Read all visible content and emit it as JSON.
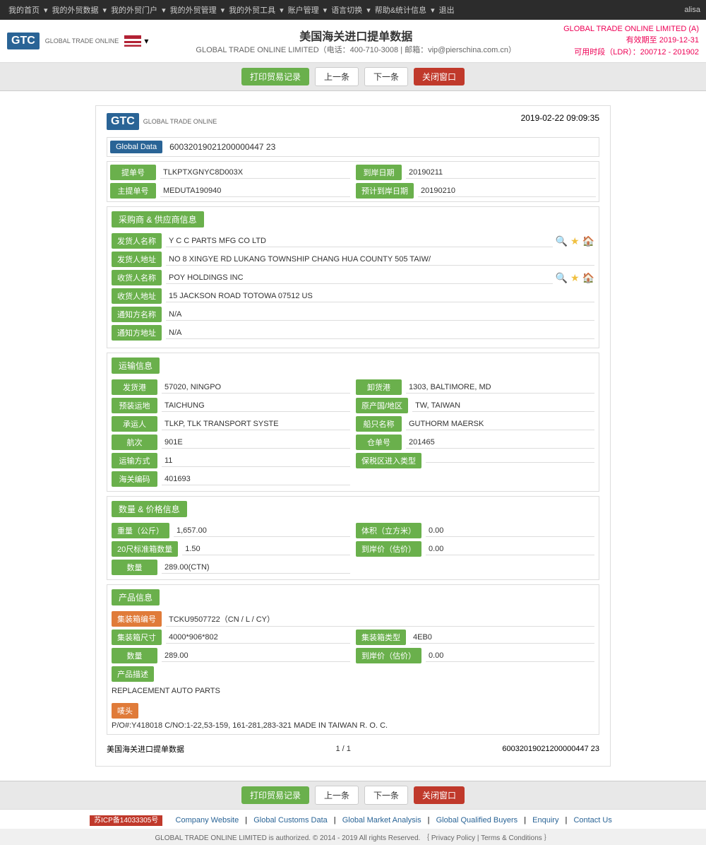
{
  "topnav": {
    "items": [
      "我的首页",
      "我的外贸数据",
      "我的外贸门户",
      "我的外贸管理",
      "我的外贸工具",
      "账户管理",
      "语言切换",
      "帮助&统计信息",
      "退出"
    ],
    "user": "alisa"
  },
  "header": {
    "logo": "GTC",
    "logo_sub": "GLOBAL TRADE ONLINE",
    "country": "美国海关进口提单数据",
    "company": "GLOBAL TRADE ONLINE LIMITED（电话：400-710-3008 | 邮箱：vip@pierschina.com.cn）",
    "account_title": "GLOBAL TRADE ONLINE LIMITED (A)",
    "valid_until": "有效期至 2019-12-31",
    "available_time": "可用时段（LDR）：200712 - 201902"
  },
  "toolbar": {
    "print_label": "打印贸易记录",
    "prev_label": "上一条",
    "next_label": "下一条",
    "close_label": "关闭窗口"
  },
  "document": {
    "timestamp": "2019-02-22 09:09:35",
    "global_data_label": "Global Data",
    "global_data_value": "60032019021200000447 23",
    "bill_no_label": "提单号",
    "bill_no_value": "TLKPTXGNYC8D003X",
    "arrival_date_label": "到岸日期",
    "arrival_date_value": "20190211",
    "master_bill_label": "主提单号",
    "master_bill_value": "MEDUTA190940",
    "est_arrival_label": "预计到岸日期",
    "est_arrival_value": "20190210",
    "shipper_section": "采购商 & 供应商信息",
    "shipper_name_label": "发货人名称",
    "shipper_name_value": "Y C C PARTS MFG CO LTD",
    "shipper_addr_label": "发货人地址",
    "shipper_addr_value": "NO 8 XINGYE RD LUKANG TOWNSHIP CHANG HUA COUNTY 505 TAIW/",
    "consignee_name_label": "收货人名称",
    "consignee_name_value": "POY HOLDINGS INC",
    "consignee_addr_label": "收货人地址",
    "consignee_addr_value": "15 JACKSON ROAD TOTOWA 07512 US",
    "notify_name_label": "通知方名称",
    "notify_name_value": "N/A",
    "notify_addr_label": "通知方地址",
    "notify_addr_value": "N/A",
    "transport_section": "运输信息",
    "origin_port_label": "发货港",
    "origin_port_value": "57020, NINGPO",
    "dest_port_label": "卸货港",
    "dest_port_value": "1303, BALTIMORE, MD",
    "loading_place_label": "预装运地",
    "loading_place_value": "TAICHUNG",
    "origin_country_label": "原产国/地区",
    "origin_country_value": "TW, TAIWAN",
    "carrier_label": "承运人",
    "carrier_value": "TLKP, TLK TRANSPORT SYSTE",
    "vessel_label": "船只名称",
    "vessel_value": "GUTHORM MAERSK",
    "flight_label": "航次",
    "flight_value": "901E",
    "warehouse_label": "仓单号",
    "warehouse_value": "201465",
    "transport_mode_label": "运输方式",
    "transport_mode_value": "11",
    "bonded_label": "保税区进入类型",
    "bonded_value": "",
    "customs_label": "海关编码",
    "customs_value": "401693",
    "qty_section": "数量 & 价格信息",
    "weight_label": "重量（公斤）",
    "weight_value": "1,657.00",
    "volume_label": "体积（立方米）",
    "volume_value": "0.00",
    "container20_label": "20尺标准箱数量",
    "container20_value": "1.50",
    "arrival_price_label": "到岸价（估价）",
    "arrival_price_value": "0.00",
    "qty_label": "数量",
    "qty_value": "289.00(CTN)",
    "product_section": "产品信息",
    "container_id_label": "集装箱编号",
    "container_id_value": "TCKU9507722（CN / L / CY）",
    "container_size_label": "集装箱尺寸",
    "container_size_value": "4000*906*802",
    "container_type_label": "集装箱类型",
    "container_type_value": "4EB0",
    "product_qty_label": "数量",
    "product_qty_value": "289.00",
    "product_price_label": "到岸价（估价）",
    "product_price_value": "0.00",
    "product_desc_label": "产品描述",
    "product_desc_value": "REPLACEMENT AUTO PARTS",
    "mark_label": "唛头",
    "mark_value": "P/O#:Y418018 C/NO:1-22,53-159, 161-281,283-321 MADE IN TAIWAN R. O. C.",
    "bottom_label": "美国海关进口提单数据",
    "page_num": "1 / 1",
    "bottom_id": "60032019021200000447 23"
  },
  "footer_links": {
    "items": [
      "Company Website",
      "Global Customs Data",
      "Global Market Analysis",
      "Global Qualified Buyers",
      "Enquiry",
      "Contact Us"
    ]
  },
  "footer_copy": "GLOBAL TRADE ONLINE LIMITED is authorized. © 2014 - 2019 All rights Reserved.  ｛  Privacy Policy  |  Terms & Conditions  ｝",
  "icp": "苏ICP备14033305号"
}
